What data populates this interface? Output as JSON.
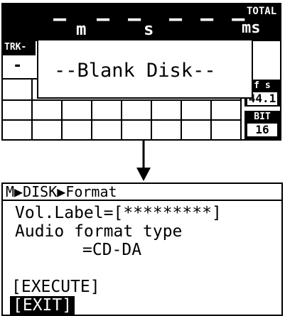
{
  "display": {
    "top_bar": {
      "minutes_dash": "–",
      "minutes_unit": "m",
      "seconds_dash": "– –",
      "seconds_unit": "s",
      "frames_dash": "– – –",
      "total_label": "TOTAL",
      "total_unit": "ms"
    },
    "track_label": "TRK-",
    "track_value": "-",
    "fs": {
      "label": "f s",
      "value": "44.1"
    },
    "bit": {
      "label": "BIT",
      "value": "16"
    },
    "popup_message": "--Blank Disk--"
  },
  "menu": {
    "breadcrumb": "M▶DISK▶Format",
    "vol_label_line": "Vol.Label=[*********]",
    "audio_format_line1": "Audio format type",
    "audio_format_line2": "=CD-DA",
    "execute_label": "[EXECUTE]",
    "exit_label": "[EXIT]"
  },
  "colors": {
    "lcd_dark": "#000000",
    "lcd_light": "#ffffff"
  }
}
